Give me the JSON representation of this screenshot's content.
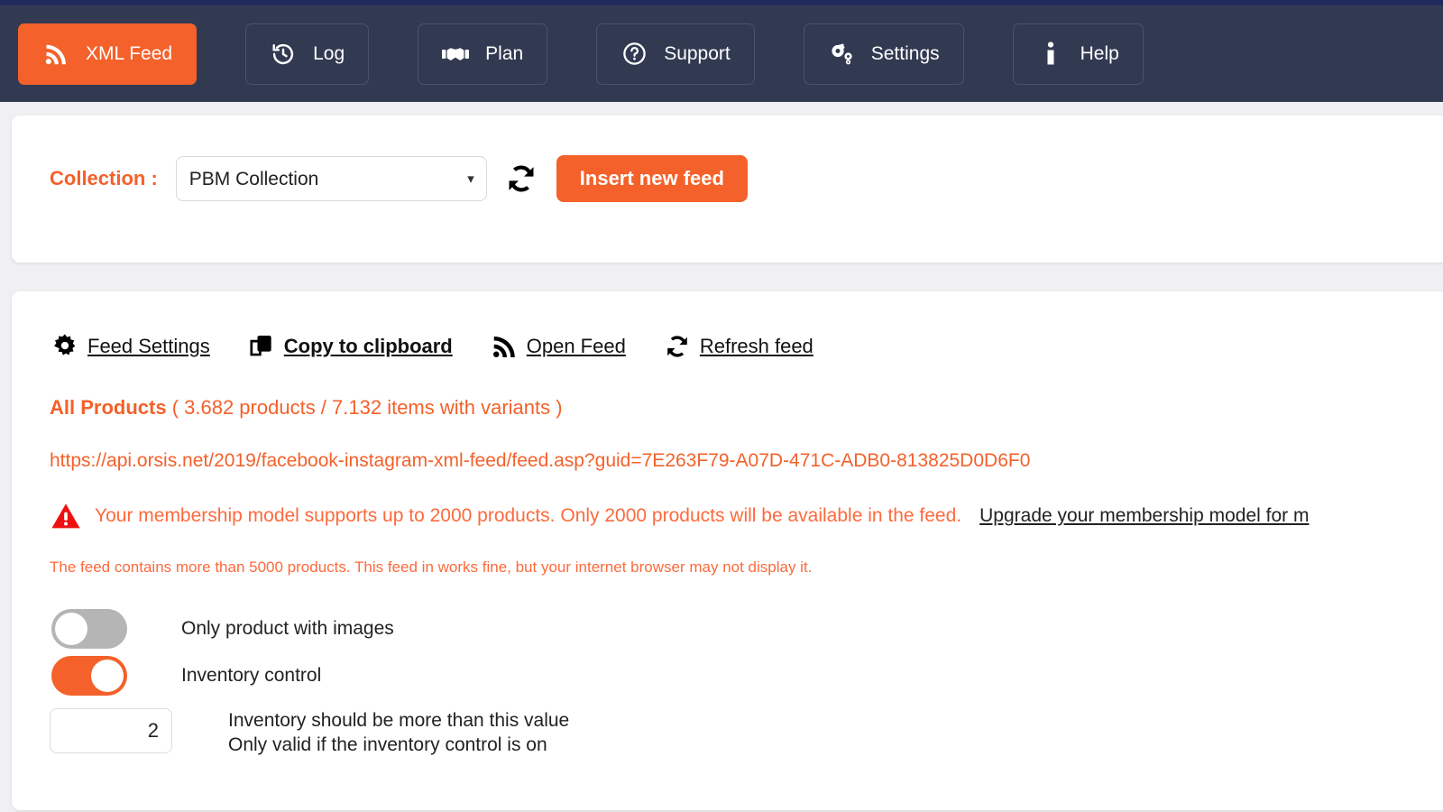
{
  "navbar": {
    "items": [
      {
        "label": "XML Feed",
        "icon": "rss-icon",
        "active": true
      },
      {
        "label": "Log",
        "icon": "history-icon",
        "active": false
      },
      {
        "label": "Plan",
        "icon": "handshake-icon",
        "active": false
      },
      {
        "label": "Support",
        "icon": "question-circle-icon",
        "active": false
      },
      {
        "label": "Settings",
        "icon": "gears-icon",
        "active": false
      },
      {
        "label": "Help",
        "icon": "info-icon",
        "active": false
      }
    ]
  },
  "collection": {
    "label": "Collection :",
    "selected": "PBM Collection",
    "options": [
      "PBM Collection"
    ],
    "refresh_icon": "refresh-icon",
    "insert_button": "Insert new feed"
  },
  "feed": {
    "toolbar": [
      {
        "label": "Feed Settings",
        "icon": "gear-icon",
        "bold": false
      },
      {
        "label": "Copy to clipboard",
        "icon": "clipboard-icon",
        "bold": true
      },
      {
        "label": "Open Feed",
        "icon": "rss-icon",
        "bold": false
      },
      {
        "label": "Refresh feed",
        "icon": "refresh-icon",
        "bold": false
      }
    ],
    "products_title": "All Products",
    "products_counts": "( 3.682 products / 7.132 items with variants )",
    "url": "https://api.orsis.net/2019/facebook-instagram-xml-feed/feed.asp?guid=7E263F79-A07D-471C-ADB0-813825D0D6F0",
    "warning_icon": "warning-triangle-icon",
    "warning_text": "Your membership model supports up to 2000 products. Only 2000 products will be available in the feed.",
    "warning_link": "Upgrade your membership model for m",
    "note_text": "The feed contains more than 5000 products. This feed in works fine, but your internet browser may not display it.",
    "toggles": [
      {
        "label": "Only product with images",
        "state": "off"
      },
      {
        "label": "Inventory control",
        "state": "on"
      }
    ],
    "inventory_value": "2",
    "inventory_desc_line1": "Inventory should be more than this value",
    "inventory_desc_line2": "Only valid if the inventory control is on"
  },
  "colors": {
    "accent": "#f4612a",
    "navbar": "#323a52",
    "top_strip": "#202a5e",
    "warn_red": "#ee1111",
    "warn_text": "#fd6a3c",
    "page_bg": "#f0f0f2"
  }
}
